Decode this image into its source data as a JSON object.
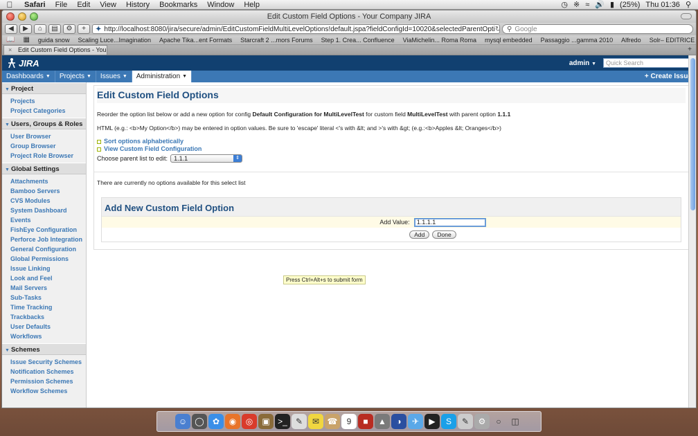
{
  "menubar": {
    "app": "Safari",
    "items": [
      "File",
      "Edit",
      "View",
      "History",
      "Bookmarks",
      "Window",
      "Help"
    ],
    "battery": "(25%)",
    "clock": "Thu 01:36"
  },
  "browser": {
    "window_title": "Edit Custom Field Options - Your Company JIRA",
    "url": "http://localhost:8080/jira/secure/admin/EditCustomFieldMultiLevelOptions!default.jspa?fieldConfigId=10020&selectedParentOpti",
    "search_placeholder": "Google",
    "bookmarks": [
      "guida snow",
      "Scaling Luce...Imagination",
      "Apache Tika...ent Formats",
      "Starcraft 2 ...mors Forums",
      "Step 1. Crea... Confluence",
      "ViaMichelin... Roma Roma",
      "mysql embedded",
      "Passaggio ...gamma 2010",
      "Alfredo",
      "Solr– EDITRICE"
    ],
    "tab_title": "Edit Custom Field Options - Your ..."
  },
  "jira": {
    "logo": "JIRA",
    "user": "admin",
    "quick_search_placeholder": "Quick Search",
    "nav": [
      "Dashboards",
      "Projects",
      "Issues",
      "Administration"
    ],
    "create_issue": "+ Create Issue"
  },
  "sidebar": {
    "sections": [
      {
        "title": "Project",
        "items": [
          "Projects",
          "Project Categories"
        ]
      },
      {
        "title": "Users, Groups & Roles",
        "items": [
          "User Browser",
          "Group Browser",
          "Project Role Browser"
        ]
      },
      {
        "title": "Global Settings",
        "items": [
          "Attachments",
          "Bamboo Servers",
          "CVS Modules",
          "System Dashboard",
          "Events",
          "FishEye Configuration",
          "Perforce Job Integration",
          "General Configuration",
          "Global Permissions",
          "Issue Linking",
          "Look and Feel",
          "Mail Servers",
          "Sub-Tasks",
          "Time Tracking",
          "Trackbacks",
          "User Defaults",
          "Workflows"
        ]
      },
      {
        "title": "Schemes",
        "items": [
          "Issue Security Schemes",
          "Notification Schemes",
          "Permission Schemes",
          "Workflow Schemes"
        ]
      }
    ]
  },
  "content": {
    "title": "Edit Custom Field Options",
    "desc_pre": "Reorder the option list below or add a new option for config ",
    "config_name": "Default Configuration for MultiLevelTest",
    "desc_mid": " for custom field ",
    "field_name": "MultiLevelTest",
    "desc_mid2": " with parent option ",
    "parent_option": "1.1.1",
    "html_note": "HTML (e.g.: <b>My Option</b>) may be entered in option values. Be sure to 'escape' literal <'s with &lt; and >'s with &gt; (e.g.:<b>Apples &lt; Oranges</b>)",
    "sort_link": "Sort options alphabetically",
    "view_link": "View Custom Field Configuration",
    "choose_label": "Choose parent list to edit:",
    "parent_select_value": "1.1.1",
    "no_options": "There are currently no options available for this select list",
    "add_title": "Add New Custom Field Option",
    "add_label": "Add Value:",
    "add_value": "1.1.1.1",
    "add_button": "Add",
    "done_button": "Done",
    "tooltip": "Press Ctrl+Alt+s to submit form"
  }
}
